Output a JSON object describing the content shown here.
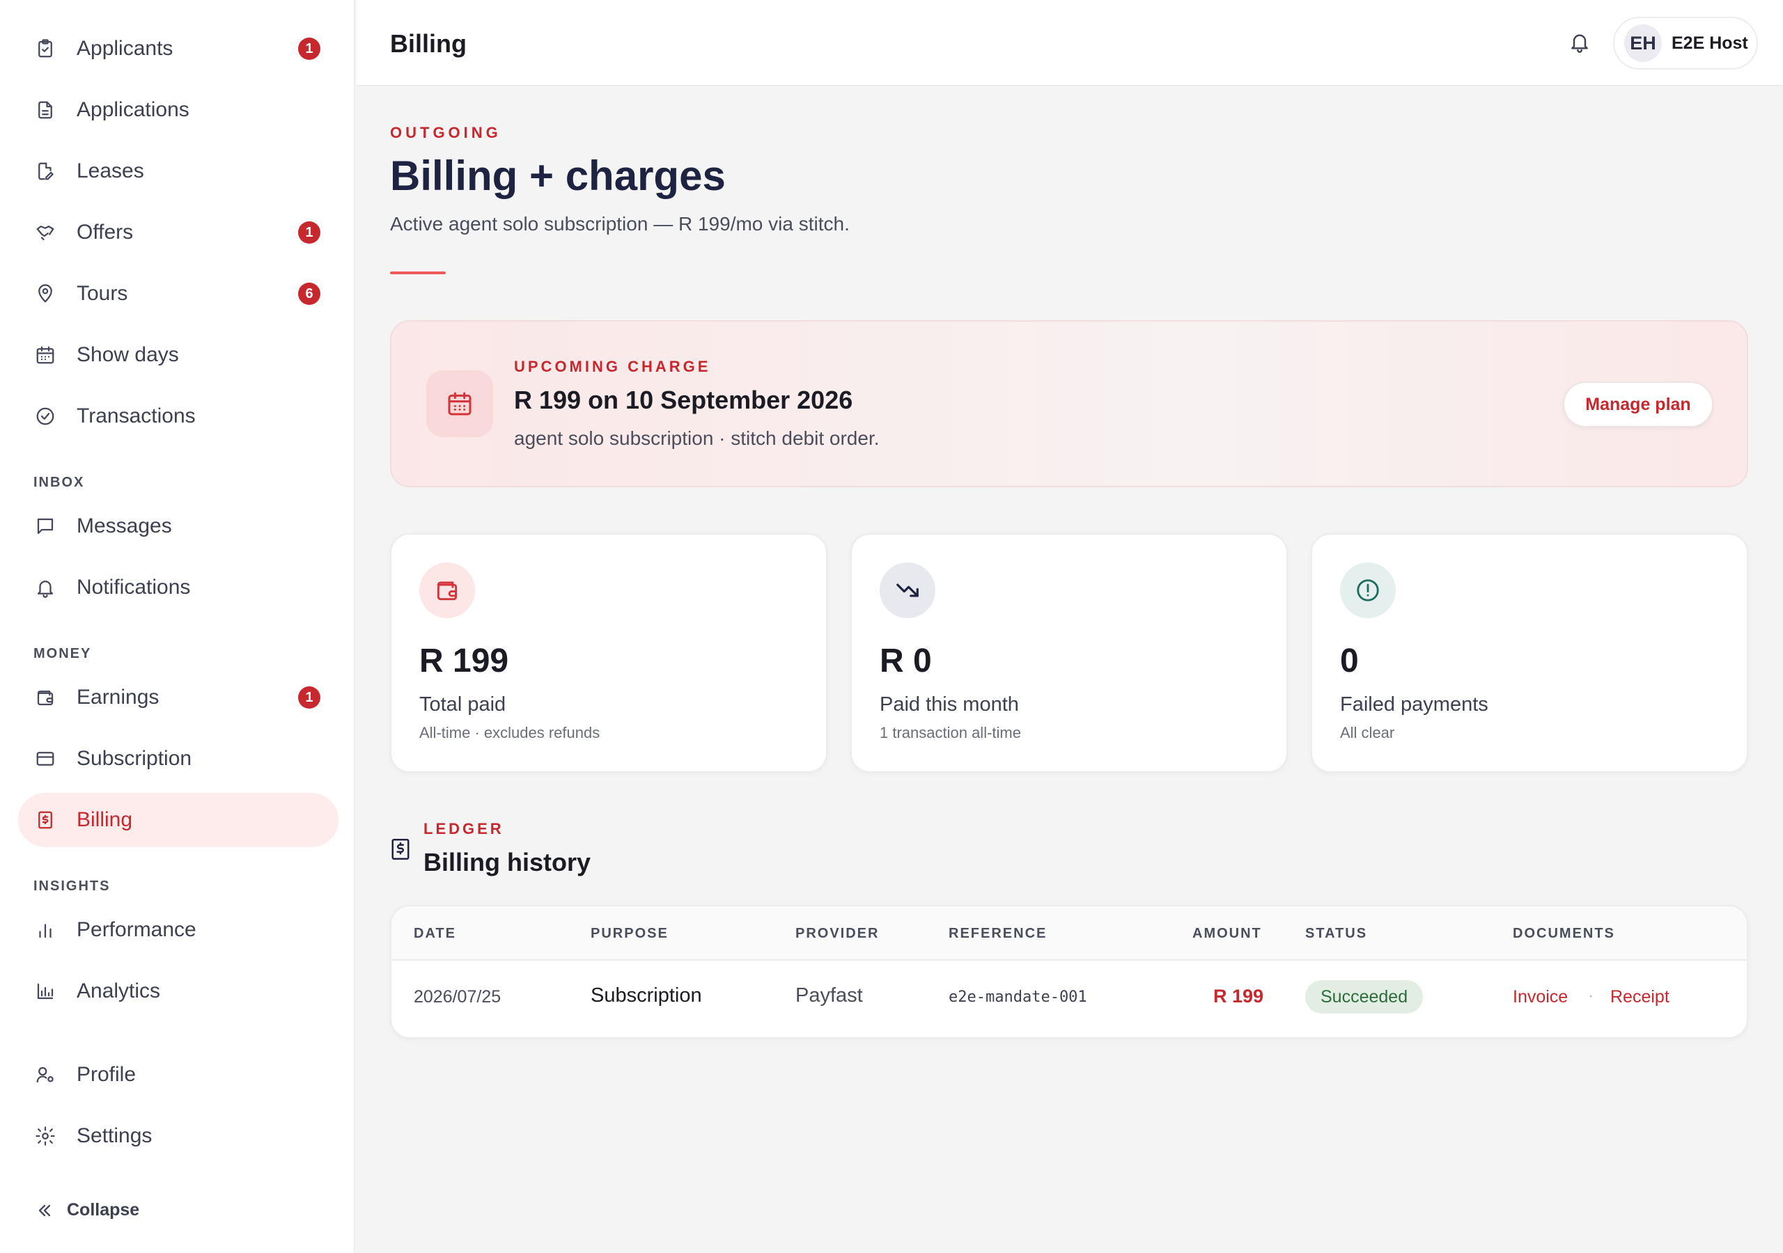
{
  "header": {
    "title": "Billing",
    "user_initials": "EH",
    "user_name": "E2E Host"
  },
  "sidebar": {
    "items": [
      {
        "label": "Applicants",
        "badge": "1"
      },
      {
        "label": "Applications"
      },
      {
        "label": "Leases"
      },
      {
        "label": "Offers",
        "badge": "1"
      },
      {
        "label": "Tours",
        "badge": "6"
      },
      {
        "label": "Show days"
      },
      {
        "label": "Transactions"
      }
    ],
    "inbox_label": "INBOX",
    "inbox_items": [
      {
        "label": "Messages"
      },
      {
        "label": "Notifications"
      }
    ],
    "money_label": "MONEY",
    "money_items": [
      {
        "label": "Earnings",
        "badge": "1"
      },
      {
        "label": "Subscription"
      },
      {
        "label": "Billing"
      }
    ],
    "insights_label": "INSIGHTS",
    "insights_items": [
      {
        "label": "Performance"
      },
      {
        "label": "Analytics"
      }
    ],
    "bottom_items": [
      {
        "label": "Profile"
      },
      {
        "label": "Settings"
      }
    ],
    "collapse_label": "Collapse"
  },
  "page": {
    "eyebrow": "OUTGOING",
    "title": "Billing + charges",
    "subtitle": "Active agent solo subscription — R 199/mo via stitch."
  },
  "upcoming": {
    "label": "UPCOMING CHARGE",
    "title": "R 199 on 10 September 2026",
    "subtitle": "agent solo subscription · stitch debit order.",
    "button": "Manage plan"
  },
  "stats": [
    {
      "value": "R 199",
      "label": "Total paid",
      "note": "All-time · excludes refunds"
    },
    {
      "value": "R 0",
      "label": "Paid this month",
      "note": "1 transaction all-time"
    },
    {
      "value": "0",
      "label": "Failed payments",
      "note": "All clear"
    }
  ],
  "ledger": {
    "label": "LEDGER",
    "title": "Billing history",
    "columns": [
      "DATE",
      "PURPOSE",
      "PROVIDER",
      "REFERENCE",
      "AMOUNT",
      "STATUS",
      "DOCUMENTS"
    ],
    "rows": [
      {
        "date": "2026/07/25",
        "purpose": "Subscription",
        "provider": "Payfast",
        "reference": "e2e-mandate-001",
        "amount": "R 199",
        "status": "Succeeded",
        "invoice": "Invoice",
        "separator": "·",
        "receipt": "Receipt"
      }
    ]
  },
  "colors": {
    "accent": "#c6282e",
    "active_bg": "#fdeceb",
    "success_bg": "#e2eee4",
    "success_text": "#2f6b3a"
  }
}
